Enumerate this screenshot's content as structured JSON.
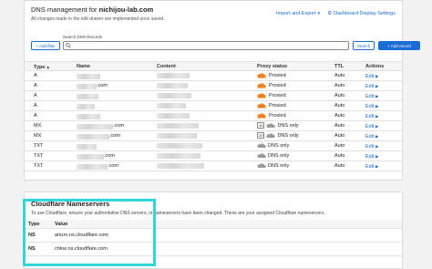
{
  "dns": {
    "title_prefix": "DNS management for",
    "domain": "nichijou-lab.com",
    "subtitle": "All changes made in the edit drawer are implemented once saved.",
    "import_export": "Import and Export",
    "dashboard_settings": "Dashboard Display Settings",
    "search_label": "Search DNS Records",
    "add_filter": "Add filter",
    "search_button": "Search",
    "add_record": "Add record",
    "columns": {
      "type": "Type",
      "name": "Name",
      "content": "Content",
      "proxy": "Proxy status",
      "ttl": "TTL",
      "actions": "Actions"
    },
    "rows": [
      {
        "type": "A",
        "name_suffix": "",
        "proxy": "Proxied",
        "priority": "",
        "ttl": "Auto",
        "action": "Edit"
      },
      {
        "type": "A",
        "name_suffix": ".com",
        "proxy": "Proxied",
        "priority": "",
        "ttl": "Auto",
        "action": "Edit"
      },
      {
        "type": "A",
        "name_suffix": "",
        "proxy": "Proxied",
        "priority": "",
        "ttl": "Auto",
        "action": "Edit"
      },
      {
        "type": "A",
        "name_suffix": "",
        "proxy": "Proxied",
        "priority": "",
        "ttl": "Auto",
        "action": "Edit"
      },
      {
        "type": "A",
        "name_suffix": "",
        "proxy": "Proxied",
        "priority": "",
        "ttl": "Auto",
        "action": "Edit"
      },
      {
        "type": "MX",
        "name_suffix": ".com",
        "proxy": "DNS only",
        "priority": "10",
        "ttl": "Auto",
        "action": "Edit"
      },
      {
        "type": "MX",
        "name_suffix": ".com",
        "proxy": "DNS only",
        "priority": "20",
        "ttl": "Auto",
        "action": "Edit"
      },
      {
        "type": "TXT",
        "name_suffix": "",
        "proxy": "DNS only",
        "priority": "",
        "ttl": "Auto",
        "action": "Edit"
      },
      {
        "type": "TXT",
        "name_suffix": ".com",
        "proxy": "DNS only",
        "priority": "",
        "ttl": "Auto",
        "action": "Edit"
      },
      {
        "type": "TXT",
        "name_suffix": ".com",
        "proxy": "DNS only",
        "priority": "",
        "ttl": "Auto",
        "action": "Edit"
      }
    ]
  },
  "nameservers": {
    "title": "Cloudflare Nameservers",
    "description": "To use Cloudflare, ensure your authoritative DNS servers, or nameservers have been changed. These are your assigned Cloudflare nameservers.",
    "col_type": "Type",
    "col_value": "Value",
    "rows": [
      {
        "type": "NS",
        "value": "arturo.ns.cloudflare.com"
      },
      {
        "type": "NS",
        "value": "chloe.ns.cloudflare.com"
      }
    ]
  },
  "colors": {
    "accent": "#1a6cd6",
    "proxied_orange": "#f38020",
    "highlight": "#2fd6dc"
  },
  "icons": [
    "chevron-down-icon",
    "gear-icon",
    "plus-icon",
    "search-icon",
    "sort-up-icon",
    "orange-cloud-icon",
    "grey-cloud-icon",
    "arrow-right-icon"
  ]
}
